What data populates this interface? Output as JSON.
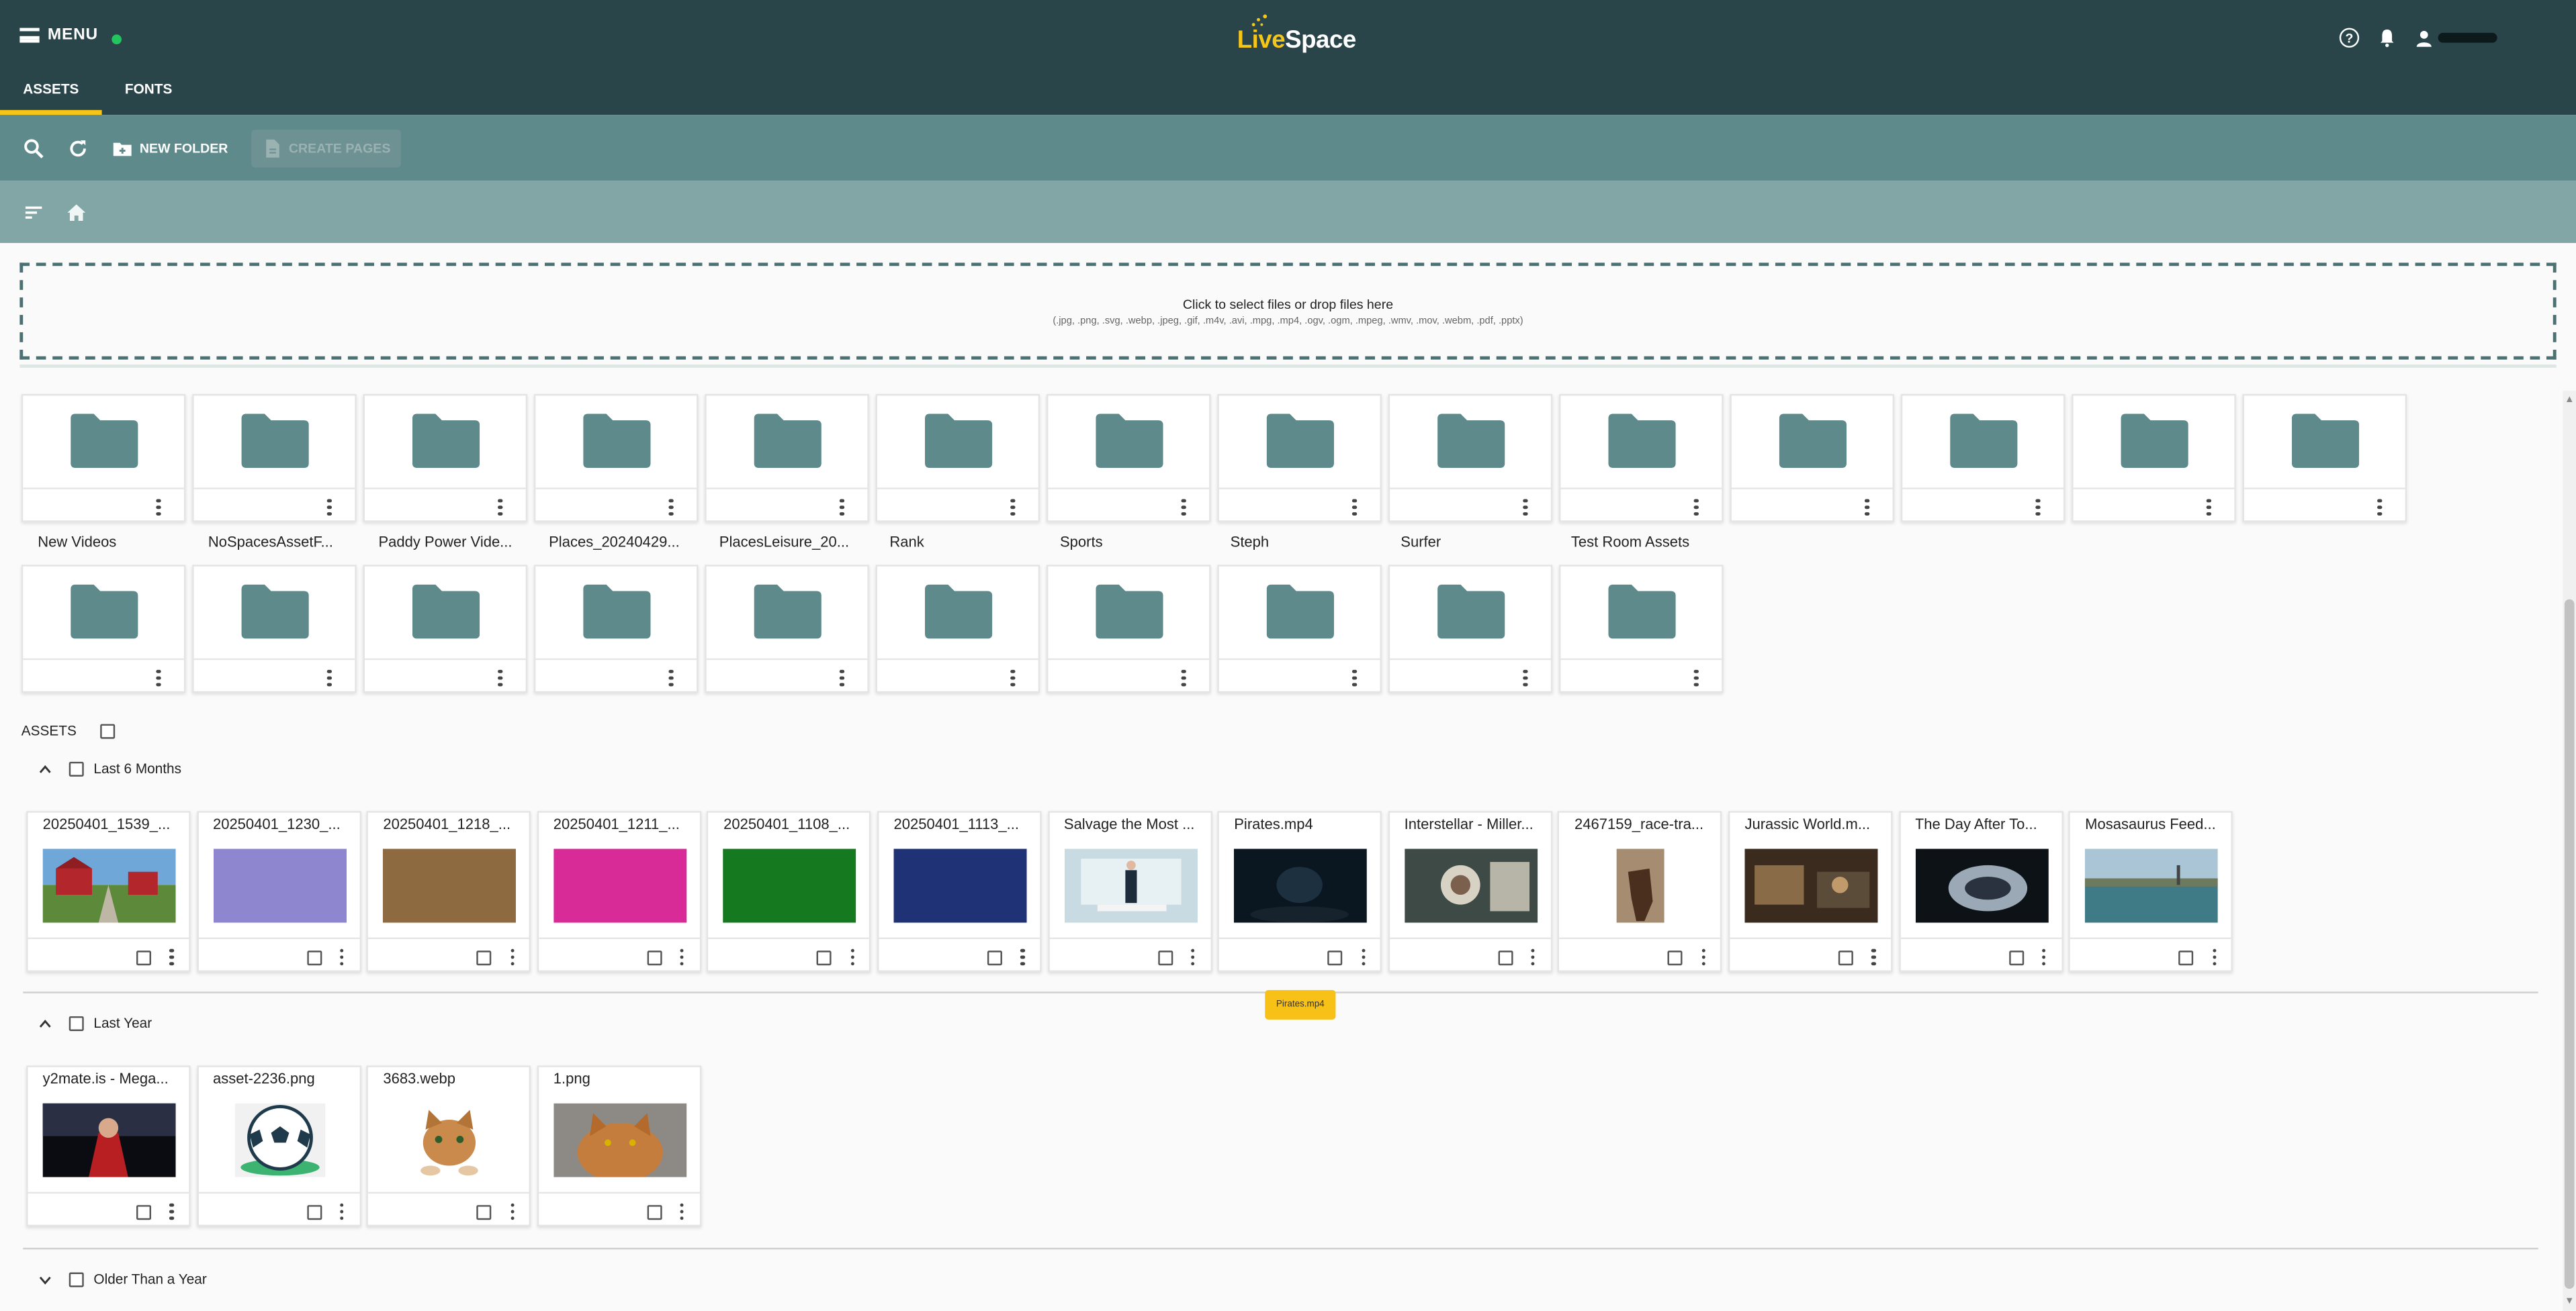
{
  "header": {
    "menu_label": "MENU",
    "logo_live": "Live",
    "logo_space": "Space",
    "help_icon": "help-circle-icon",
    "notifications_icon": "bell-icon",
    "user_icon": "person-icon",
    "colors": {
      "bar": "#29454a",
      "accent": "#f5c518",
      "online": "#22c55e"
    }
  },
  "tabs": [
    {
      "label": "ASSETS",
      "active": true
    },
    {
      "label": "FONTS",
      "active": false
    }
  ],
  "toolbar": {
    "search_icon": "search-icon",
    "refresh_icon": "refresh-icon",
    "new_folder_label": "NEW FOLDER",
    "create_pages_label": "CREATE PAGES",
    "create_pages_disabled": true,
    "colors": {
      "toolbar": "#5f8a8b",
      "navbar": "#82a6a6"
    }
  },
  "navbar": {
    "sort_icon": "sort-icon",
    "home_icon": "home-icon"
  },
  "dropzone": {
    "title": "Click to select files or drop files here",
    "formats": "(.jpg, .png, .svg, .webp, .jpeg, .gif, .m4v, .avi, .mpg, .mp4, .ogv, .ogm, .mpeg, .wmv, .mov, .webm, .pdf, .pptx)"
  },
  "folders_row1_count": 14,
  "folders_row2": [
    "New Videos",
    "NoSpacesAssetF...",
    "Paddy Power Vide...",
    "Places_20240429...",
    "PlacesLeisure_20...",
    "Rank",
    "Sports",
    "Steph",
    "Surfer",
    "Test Room Assets"
  ],
  "assets_label": "ASSETS",
  "groups": [
    {
      "label": "Last 6 Months",
      "expanded": true,
      "items": [
        {
          "name": "20250401_1539_...",
          "thumb": "farm"
        },
        {
          "name": "20250401_1230_...",
          "thumb": "#8f86d0"
        },
        {
          "name": "20250401_1218_...",
          "thumb": "#8d6a3f"
        },
        {
          "name": "20250401_1211_...",
          "thumb": "#d92b98"
        },
        {
          "name": "20250401_1108_...",
          "thumb": "#157a1f"
        },
        {
          "name": "20250401_1113_...",
          "thumb": "#1e3275"
        },
        {
          "name": "Salvage the Most ...",
          "thumb": "room"
        },
        {
          "name": "Pirates.mp4",
          "thumb": "dark"
        },
        {
          "name": "Interstellar - Miller...",
          "thumb": "astronaut"
        },
        {
          "name": "2467159_race-tra...",
          "thumb": "horse"
        },
        {
          "name": "Jurassic World.m...",
          "thumb": "jurassic"
        },
        {
          "name": "The Day After To...",
          "thumb": "ship"
        },
        {
          "name": "Mosasaurus Feed...",
          "thumb": "lake"
        }
      ]
    },
    {
      "label": "Last Year",
      "expanded": true,
      "items": [
        {
          "name": "y2mate.is - Mega...",
          "thumb": "hero"
        },
        {
          "name": "asset-2236.png",
          "thumb": "ball"
        },
        {
          "name": "3683.webp",
          "thumb": "cat"
        },
        {
          "name": "1.png",
          "thumb": "cat2"
        }
      ]
    },
    {
      "label": "Older Than a Year",
      "expanded": false,
      "items": []
    }
  ],
  "tooltip": "Pirates.mp4"
}
